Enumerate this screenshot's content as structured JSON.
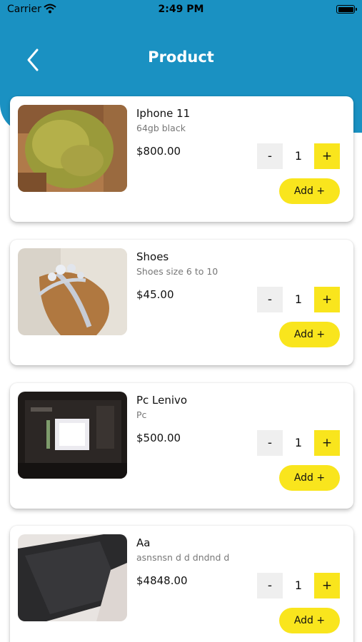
{
  "status_bar": {
    "carrier": "Carrier",
    "time": "2:49 PM"
  },
  "header": {
    "title": "Product"
  },
  "products": [
    {
      "name": "Iphone 11",
      "description": "64gb black",
      "price": "$800.00",
      "quantity": "1",
      "minus_label": "-",
      "plus_label": "+",
      "add_label": "Add +",
      "image": "food-photo"
    },
    {
      "name": "Shoes",
      "description": "Shoes size 6 to 10",
      "price": "$45.00",
      "quantity": "1",
      "minus_label": "-",
      "plus_label": "+",
      "add_label": "Add +",
      "image": "sandal-photo"
    },
    {
      "name": "Pc Lenivo",
      "description": "Pc",
      "price": "$500.00",
      "quantity": "1",
      "minus_label": "-",
      "plus_label": "+",
      "add_label": "Add +",
      "image": "screen-photo"
    },
    {
      "name": "Aa",
      "description": "asnsnsn d d dndnd d",
      "price": "$4848.00",
      "quantity": "1",
      "minus_label": "-",
      "plus_label": "+",
      "add_label": "Add +",
      "image": "phone-photo"
    }
  ],
  "colors": {
    "header": "#1a91c2",
    "accent": "#f9e51d",
    "stepper": "#efefef"
  }
}
